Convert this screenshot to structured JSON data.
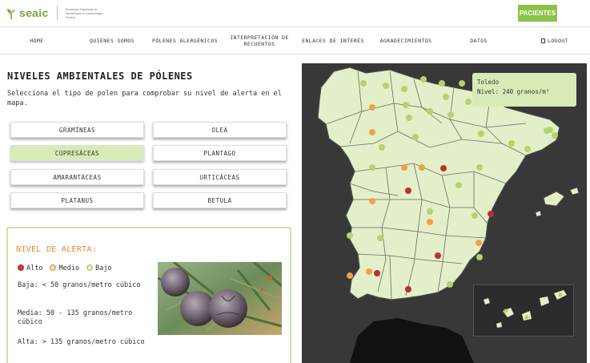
{
  "header": {
    "brand": "seaic",
    "tagline": "Sociedad Española de Alergología e Inmunología Clínica",
    "patients_button": "PACIENTES"
  },
  "nav": {
    "items": [
      {
        "label": "HOME"
      },
      {
        "label": "QUIÉNES SOMOS"
      },
      {
        "label": "PÓLENES ALERGÉNICOS"
      },
      {
        "label": "INTERPRETACIÓN DE RECUENTOS"
      },
      {
        "label": "ENLACES DE INTERÉS"
      },
      {
        "label": "AGRADECIMIENTOS"
      },
      {
        "label": "DATOS"
      },
      {
        "label": "LOGOUT"
      }
    ]
  },
  "main": {
    "title": "NIVELES AMBIENTALES DE PÓLENES",
    "subtitle": "Selecciona el tipo de polen para comprobar su nivel de alerta en el mapa.",
    "pollen_types": [
      {
        "label": "GRAMÍNEAS",
        "selected": false
      },
      {
        "label": "OLEA",
        "selected": false
      },
      {
        "label": "CUPRESÁCEAS",
        "selected": true
      },
      {
        "label": "PLANTAGO",
        "selected": false
      },
      {
        "label": "AMARANTÁCEAS",
        "selected": false
      },
      {
        "label": "URTICÁCEAS",
        "selected": false
      },
      {
        "label": "PLATANUS",
        "selected": false
      },
      {
        "label": "BETULA",
        "selected": false
      }
    ]
  },
  "alert": {
    "title": "NIVEL DE ALERTA:",
    "legend": [
      {
        "label": "Alto",
        "color": "#b8312f"
      },
      {
        "label": "Medio",
        "color": "#f0a04b"
      },
      {
        "label": "Bajo",
        "color": "#b5d36b"
      }
    ],
    "levels": {
      "low": "Baja: < 50 granos/metro cúbico",
      "medium": "Media: 50 - 135 granos/metro cúbico",
      "high": "Alta: > 135 granos/metro cúbico"
    }
  },
  "map": {
    "tooltip": {
      "city": "Toledo",
      "level": "Nivel: 240 granos/m³"
    },
    "colors": {
      "land": "#e3efc8",
      "sea": "#383838",
      "high": "#b8312f",
      "medium": "#f0a04b",
      "low": "#b5d36b"
    }
  }
}
